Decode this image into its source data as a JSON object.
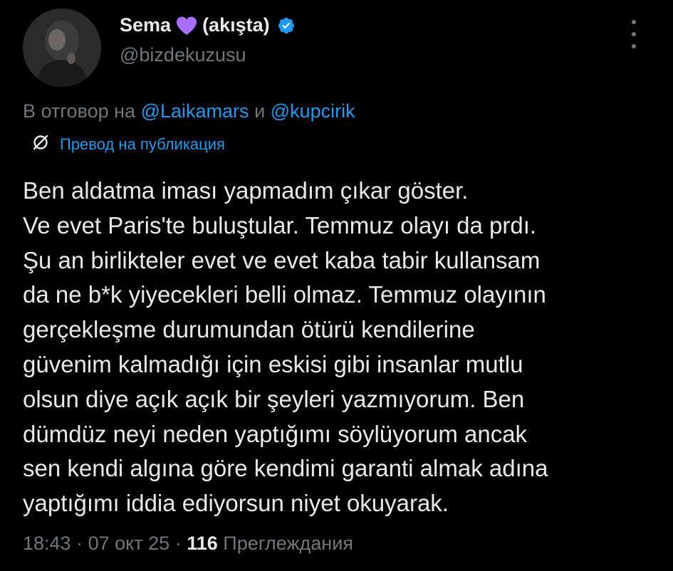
{
  "author": {
    "name": "Sema",
    "name_suffix": "(akışta)",
    "handle": "@bizdekuzusu",
    "heart_emoji": "purple-heart-icon",
    "verified_icon": "verified-badge-icon"
  },
  "reply": {
    "prefix": "В отговор на",
    "user1": "@Laikamars",
    "conjunction": "и",
    "user2": "@kupcirik"
  },
  "translate": {
    "label": "Превод на публикация",
    "icon": "translate-icon"
  },
  "post": {
    "lines": [
      "Ben aldatma iması yapmadım çıkar göster.",
      "Ve evet Paris'te buluştular. Temmuz olayı da prdı.",
      "Şu an birlikteler evet ve evet kaba tabir kullansam",
      "da ne b*k yiyecekleri belli olmaz. Temmuz olayının",
      "gerçekleşme durumundan ötürü kendilerine",
      "güvenim kalmadığı için eskisi gibi insanlar mutlu",
      "olsun diye açık açık bir şeyleri yazmıyorum. Ben",
      "dümdüz neyi neden yaptığımı söylüyorum ancak",
      "sen kendi algına göre kendimi garanti almak adına",
      "yaptığımı iddia ediyorsun niyet okuyarak."
    ]
  },
  "meta": {
    "time": "18:43",
    "separator": "·",
    "date": "07 окт 25",
    "views_count": "116",
    "views_label": "Преглеждания"
  },
  "colors": {
    "background": "#000000",
    "text": "#e7e9ea",
    "muted": "#71767b",
    "accent": "#1d9bf0",
    "heart": "#a970ff"
  }
}
